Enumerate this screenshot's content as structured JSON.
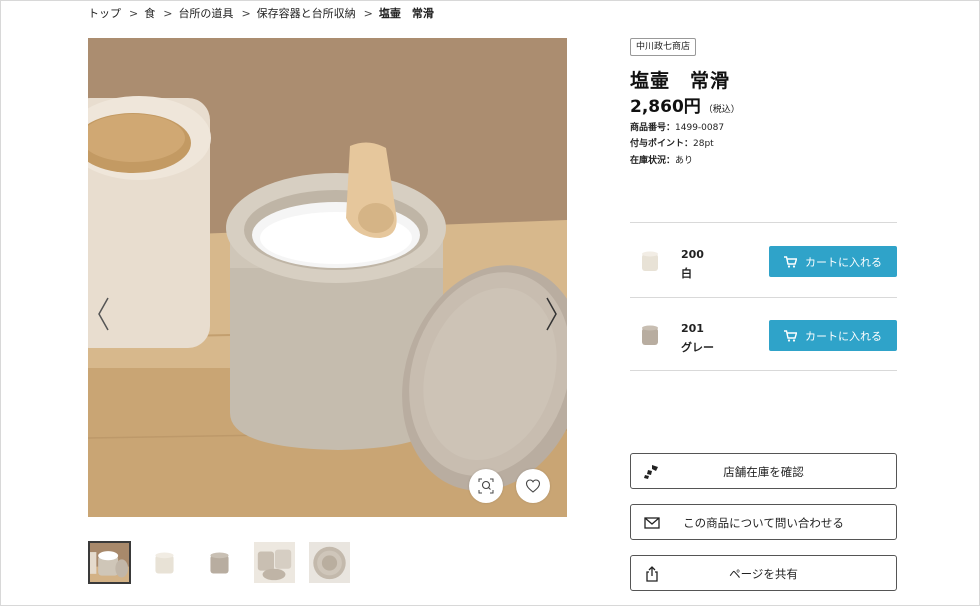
{
  "breadcrumb": {
    "items": [
      "トップ",
      "食",
      "台所の道具",
      "保存容器と台所収納"
    ],
    "separator": ">",
    "current": "塩壷　常滑"
  },
  "product": {
    "shop_badge": "中川政七商店",
    "title": "塩壷　常滑",
    "price": "2,860円",
    "tax_note": "（税込）",
    "meta": [
      {
        "key": "商品番号：",
        "value": "1499-0087"
      },
      {
        "key": "付与ポイント：",
        "value": "28pt"
      },
      {
        "key": "在庫状況：",
        "value": "あり"
      }
    ]
  },
  "variants": [
    {
      "code": "200",
      "name": "白",
      "color": "#e8e2d6",
      "cart_label": "カートに入れる"
    },
    {
      "code": "201",
      "name": "グレー",
      "color": "#b8ada0",
      "cart_label": "カートに入れる"
    }
  ],
  "actions": {
    "store_stock": "店舗在庫を確認",
    "inquiry": "この商品について問い合わせる",
    "share": "ページを共有"
  },
  "icons": {
    "prev": "chevron-left-icon",
    "next": "chevron-right-icon",
    "zoom": "zoom-icon",
    "favorite": "heart-icon",
    "cart": "cart-icon",
    "store": "store-stock-icon",
    "mail": "mail-icon",
    "share": "share-icon"
  },
  "colors": {
    "accent": "#2fa3c9",
    "border": "#555555"
  },
  "gallery": {
    "thumbnail_count": 5,
    "active_index": 0
  }
}
